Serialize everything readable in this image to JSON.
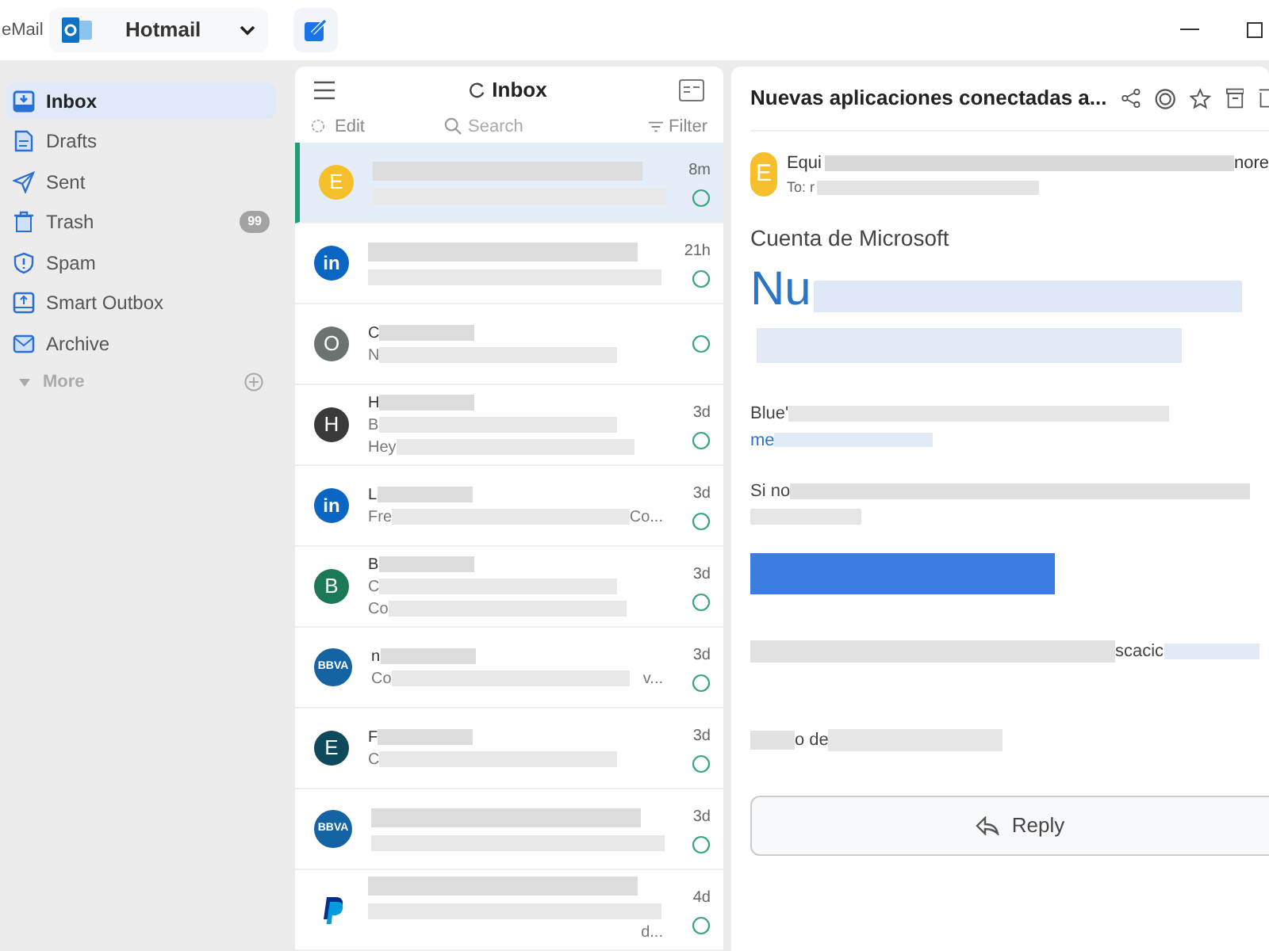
{
  "app": {
    "title": "eMail",
    "account": "Hotmail"
  },
  "sidebar": {
    "items": [
      {
        "label": "Inbox",
        "selected": true
      },
      {
        "label": "Drafts",
        "selected": false
      },
      {
        "label": "Sent",
        "selected": false
      },
      {
        "label": "Trash",
        "selected": false,
        "badge": "99"
      },
      {
        "label": "Spam",
        "selected": false
      },
      {
        "label": "Smart Outbox",
        "selected": false
      },
      {
        "label": "Archive",
        "selected": false
      }
    ],
    "more": "More"
  },
  "list": {
    "title": "Inbox",
    "edit": "Edit",
    "search_placeholder": "Search",
    "filter": "Filter",
    "messages": [
      {
        "kind": "letter",
        "avatar": "E",
        "color": "#f5c02c",
        "time": "8m",
        "selected": true
      },
      {
        "kind": "linkedin",
        "avatar": "in",
        "time": "21h",
        "selected": false
      },
      {
        "kind": "letter",
        "avatar": "O",
        "color": "#6b7370",
        "lines": [
          "C",
          "N"
        ],
        "selected": false
      },
      {
        "kind": "letter",
        "avatar": "H",
        "color": "#3a3a3a",
        "time": "3d",
        "lines": [
          "H",
          "B",
          "Hey"
        ],
        "selected": false
      },
      {
        "kind": "linkedin",
        "avatar": "in",
        "time": "3d",
        "lines": [
          "L",
          "Fre"
        ],
        "tail": "Co...",
        "selected": false
      },
      {
        "kind": "letter",
        "avatar": "B",
        "color": "#1b7a55",
        "time": "3d",
        "lines": [
          "B",
          "C",
          "Co"
        ],
        "selected": false
      },
      {
        "kind": "bbva",
        "avatar": "BBVA",
        "time": "3d",
        "lines": [
          "n",
          "Co"
        ],
        "tail": "v...",
        "selected": false
      },
      {
        "kind": "letter",
        "avatar": "E",
        "color": "#0e4a5c",
        "time": "3d",
        "lines": [
          "F",
          "C"
        ],
        "selected": false
      },
      {
        "kind": "bbva",
        "avatar": "BBVA",
        "time": "3d",
        "selected": false
      },
      {
        "kind": "paypal",
        "time": "4d",
        "tail": "d...",
        "selected": false
      }
    ]
  },
  "reader": {
    "subject": "Nuevas aplicaciones conectadas a...",
    "avatar": "E",
    "sender": "Equi",
    "sender_tail": "nore",
    "to": "To: r",
    "heading": "Cuenta de Microsoft",
    "big": "Nu",
    "p1": "Blue'",
    "p2": "me",
    "p3": "Si no",
    "p4": "scacic",
    "p5": "o de",
    "reply": "Reply"
  }
}
